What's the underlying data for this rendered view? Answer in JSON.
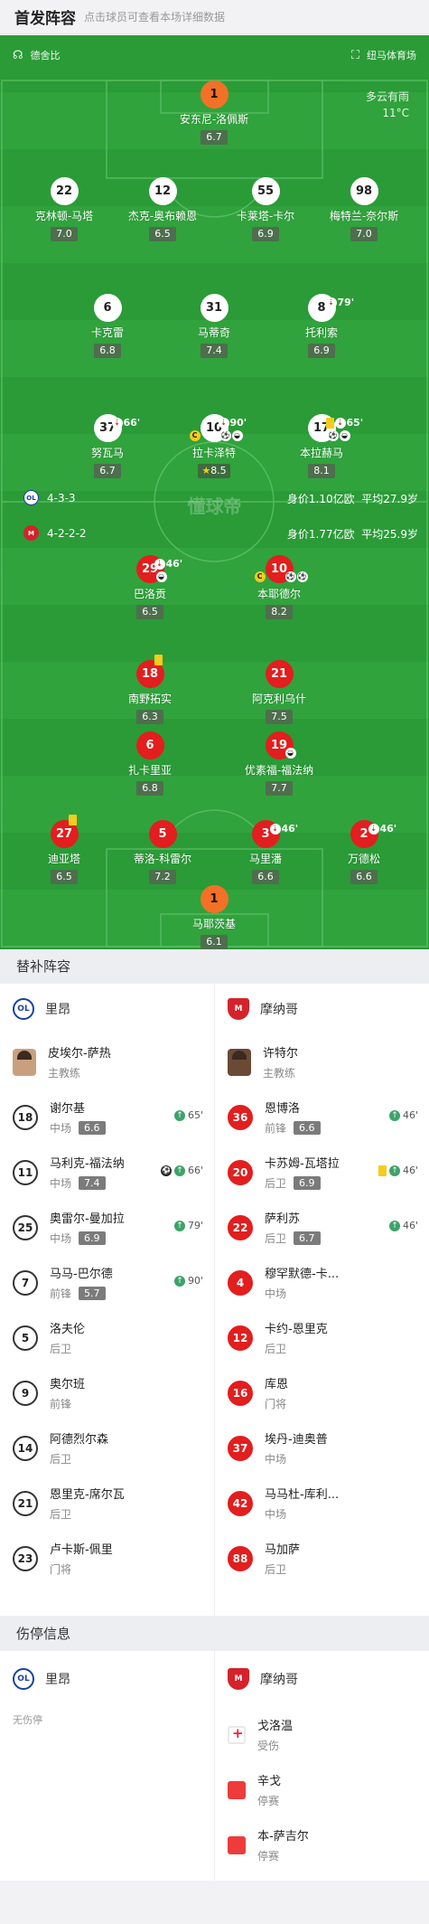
{
  "header": {
    "title": "首发阵容",
    "subtitle": "点击球员可查看本场详细数据"
  },
  "pitch": {
    "home_team": "德舍比",
    "venue": "纽马体育场",
    "weather_desc": "多云有雨",
    "temperature": "11°C",
    "watermark": "懂球帝",
    "lyon_formation": "4-3-3",
    "lyon_worth": "身价1.10亿欧",
    "lyon_age": "平均27.9岁",
    "monaco_formation": "4-2-2-2",
    "monaco_worth": "身价1.77亿欧",
    "monaco_age": "平均25.9岁",
    "players": [
      {
        "num": "1",
        "name": "安东尼-洛佩斯",
        "rating": "6.7"
      },
      {
        "num": "22",
        "name": "克林顿-马塔",
        "rating": "7.0"
      },
      {
        "num": "12",
        "name": "杰克-奥布赖恩",
        "rating": "6.5"
      },
      {
        "num": "55",
        "name": "卡莱塔-卡尔",
        "rating": "6.9"
      },
      {
        "num": "98",
        "name": "梅特兰-奈尔斯",
        "rating": "7.0"
      },
      {
        "num": "6",
        "name": "卡克雷",
        "rating": "6.8"
      },
      {
        "num": "31",
        "name": "马蒂奇",
        "rating": "7.4"
      },
      {
        "num": "8",
        "name": "托利索",
        "rating": "6.9",
        "ev": "79'"
      },
      {
        "num": "37",
        "name": "努瓦马",
        "rating": "6.7",
        "ev": "66'"
      },
      {
        "num": "10",
        "name": "拉卡泽特",
        "rating": "8.5",
        "ev": "90'"
      },
      {
        "num": "17",
        "name": "本拉赫马",
        "rating": "8.1",
        "ev": "65'"
      },
      {
        "num": "29",
        "name": "巴洛贡",
        "rating": "6.5",
        "ev": "46'"
      },
      {
        "num": "10",
        "name": "本耶德尔",
        "rating": "8.2"
      },
      {
        "num": "18",
        "name": "南野拓实",
        "rating": "6.3"
      },
      {
        "num": "21",
        "name": "阿克利乌什",
        "rating": "7.5"
      },
      {
        "num": "6",
        "name": "扎卡里亚",
        "rating": "6.8"
      },
      {
        "num": "19",
        "name": "优素福-福法纳",
        "rating": "7.7"
      },
      {
        "num": "27",
        "name": "迪亚塔",
        "rating": "6.5"
      },
      {
        "num": "5",
        "name": "蒂洛-科雷尔",
        "rating": "7.2"
      },
      {
        "num": "3",
        "name": "马里潘",
        "rating": "6.6",
        "ev": "46'"
      },
      {
        "num": "2",
        "name": "万德松",
        "rating": "6.6",
        "ev": "46'"
      },
      {
        "num": "1",
        "name": "马耶茨基",
        "rating": "6.1"
      }
    ]
  },
  "subs": {
    "title": "替补阵容",
    "lyon_name": "里昂",
    "monaco_name": "摩纳哥",
    "lyon_coach": {
      "name": "皮埃尔-萨热",
      "role": "主教练"
    },
    "monaco_coach": {
      "name": "许特尔",
      "role": "主教练"
    },
    "lyon": [
      {
        "num": "18",
        "name": "谢尔基",
        "pos": "中场",
        "rating": "6.6",
        "ev": "65'"
      },
      {
        "num": "11",
        "name": "马利克-福法纳",
        "pos": "中场",
        "rating": "7.4",
        "ev": "66'"
      },
      {
        "num": "25",
        "name": "奥雷尔-曼加拉",
        "pos": "中场",
        "rating": "6.9",
        "ev": "79'"
      },
      {
        "num": "7",
        "name": "马马-巴尔德",
        "pos": "前锋",
        "rating": "5.7",
        "ev": "90'"
      },
      {
        "num": "5",
        "name": "洛夫伦",
        "pos": "后卫"
      },
      {
        "num": "9",
        "name": "奥尔班",
        "pos": "前锋"
      },
      {
        "num": "14",
        "name": "阿德烈尔森",
        "pos": "后卫"
      },
      {
        "num": "21",
        "name": "恩里克-席尔瓦",
        "pos": "后卫"
      },
      {
        "num": "23",
        "name": "卢卡斯-佩里",
        "pos": "门将"
      }
    ],
    "monaco": [
      {
        "num": "36",
        "name": "恩博洛",
        "pos": "前锋",
        "rating": "6.6",
        "ev": "46'"
      },
      {
        "num": "20",
        "name": "卡苏姆-瓦塔拉",
        "pos": "后卫",
        "rating": "6.9",
        "ev": "46'"
      },
      {
        "num": "22",
        "name": "萨利苏",
        "pos": "后卫",
        "rating": "6.7",
        "ev": "46'"
      },
      {
        "num": "4",
        "name": "穆罕默德-卡...",
        "pos": "中场"
      },
      {
        "num": "12",
        "name": "卡约-恩里克",
        "pos": "后卫"
      },
      {
        "num": "16",
        "name": "库恩",
        "pos": "门将"
      },
      {
        "num": "37",
        "name": "埃丹-迪奥普",
        "pos": "中场"
      },
      {
        "num": "42",
        "name": "马马杜-库利...",
        "pos": "中场"
      },
      {
        "num": "88",
        "name": "马加萨",
        "pos": "后卫"
      }
    ]
  },
  "injuries": {
    "title": "伤停信息",
    "lyon_name": "里昂",
    "monaco_name": "摩纳哥",
    "lyon_none": "无伤停",
    "monaco": [
      {
        "name": "戈洛温",
        "status": "受伤"
      },
      {
        "name": "辛戈",
        "status": "停赛"
      },
      {
        "name": "本-萨吉尔",
        "status": "停赛"
      }
    ]
  }
}
